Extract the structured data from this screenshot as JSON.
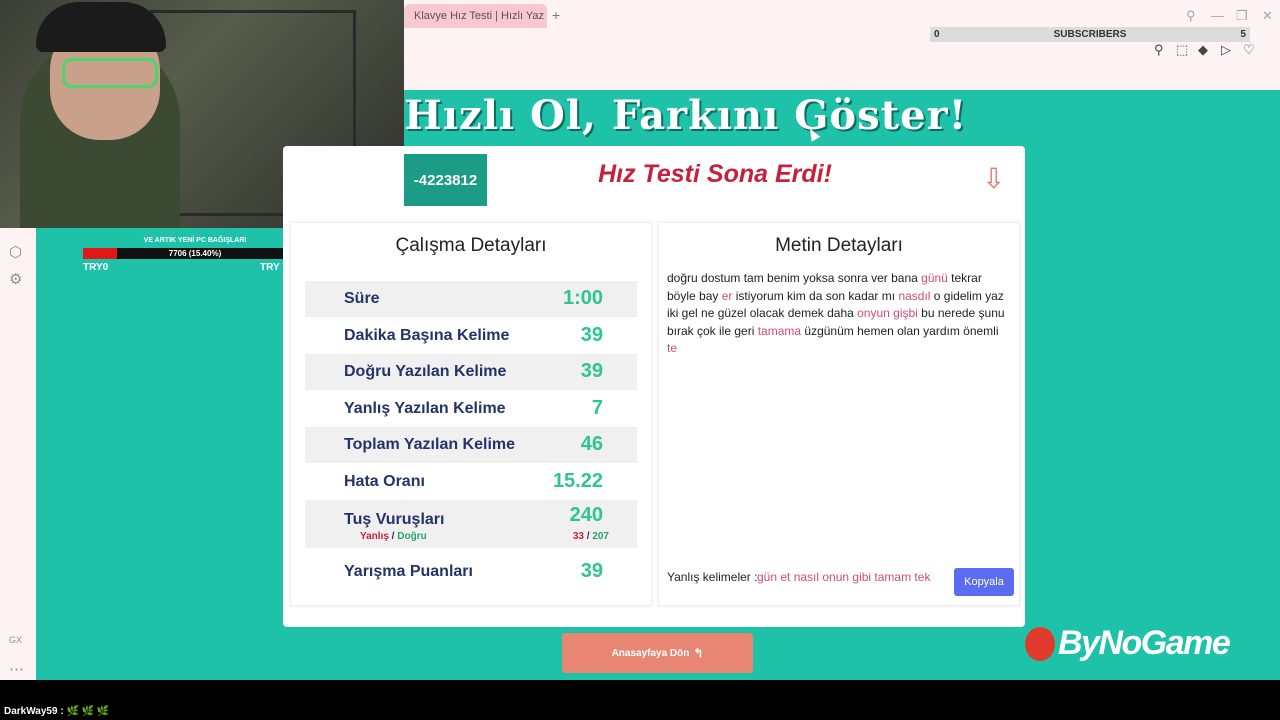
{
  "browser": {
    "tab_title": "Klavye Hız Testi | Hızlı Yaz",
    "new_tab": "+"
  },
  "overlay": {
    "subs_left": "0",
    "subs_label": "SUBSCRIBERS",
    "subs_right": "5",
    "donation_title": "VE ARTIK YENİ PC BAĞIŞLARI",
    "donation_text": "7706 (15.40%)",
    "donation_progress": 0.154,
    "try_left": "TRY0",
    "try_right": "TRY"
  },
  "page": {
    "headline": "Hızlı Ol, Farkını Göster!",
    "code": "-4223812",
    "result_title": "Hız Testi Sona Erdi!",
    "left_panel_title": "Çalışma Detayları",
    "right_panel_title": "Metin Detayları",
    "stats": {
      "sure_label": "Süre",
      "sure_val": "1:00",
      "wpm_label": "Dakika Başına Kelime",
      "wpm_val": "39",
      "correct_label": "Doğru Yazılan Kelime",
      "correct_val": "39",
      "wrong_label": "Yanlış Yazılan Kelime",
      "wrong_val": "7",
      "total_label": "Toplam Yazılan Kelime",
      "total_val": "46",
      "error_label": "Hata Oranı",
      "error_val": "15.22",
      "keys_label": "Tuş Vuruşları",
      "keys_val": "240",
      "keys_sub_wrong": "Yanlış",
      "keys_sub_sep": " / ",
      "keys_sub_correct": "Doğru",
      "keys_wrong_val": "33",
      "keys_correct_val": "207",
      "score_label": "Yarışma Puanları",
      "score_val": "39"
    },
    "text_segments": [
      {
        "t": "doğru dostum tam benim yoksa sonra ver bana ",
        "bad": false
      },
      {
        "t": "günü",
        "bad": true
      },
      {
        "t": " tekrar böyle bay ",
        "bad": false
      },
      {
        "t": "er",
        "bad": true
      },
      {
        "t": " istiyorum kim da son kadar mı ",
        "bad": false
      },
      {
        "t": "nasdıl",
        "bad": true
      },
      {
        "t": " o gidelim yaz iki gel ne güzel olacak demek daha ",
        "bad": false
      },
      {
        "t": "onyun gişbi",
        "bad": true
      },
      {
        "t": " bu nerede şunu bırak çok ile geri ",
        "bad": false
      },
      {
        "t": "tamama",
        "bad": true
      },
      {
        "t": " üzgünüm hemen olan yardım önemli ",
        "bad": false
      },
      {
        "t": "te",
        "bad": true
      }
    ],
    "wrong_words_label": "Yanlış kelimeler :",
    "wrong_words": "gün et nasıl onun gibi tamam tek",
    "copy_button": "Kopyala",
    "home_button": "Anasayfaya Dön",
    "logo": "ByNoGame"
  },
  "chat": {
    "user": "DarkWay59 :",
    "emotes": "🌿 🌿 🌿"
  },
  "colors": {
    "teal": "#1dc2a9",
    "title_red": "#c4223c",
    "value_green": "#2fc493",
    "button_blue": "#5b6cf0",
    "home_orange": "#e98673"
  }
}
